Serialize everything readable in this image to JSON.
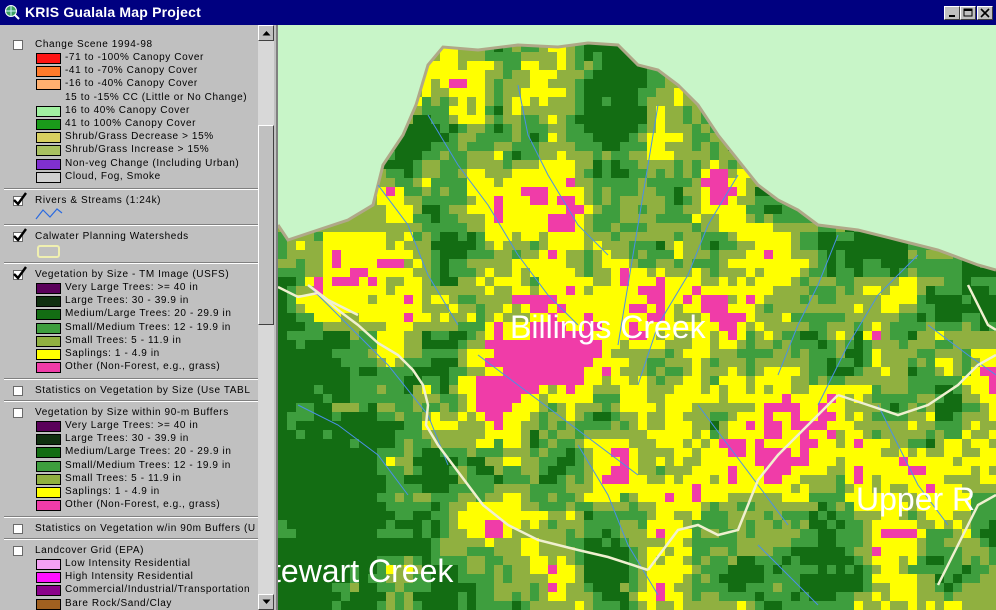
{
  "window": {
    "title": "KRIS Gualala Map Project",
    "minimize": "minimize",
    "maximize": "maximize",
    "close": "close"
  },
  "toc": {
    "groups": [
      {
        "title": "Change Scene 1994-98",
        "checked": false,
        "items": [
          {
            "label": "-71 to -100% Canopy Cover",
            "color": "#ff1414"
          },
          {
            "label": "-41 to -70% Canopy Cover",
            "color": "#ff7a2a"
          },
          {
            "label": "-16 to -40% Canopy Cover",
            "color": "#ffb070"
          },
          {
            "label": "15 to -15% CC (Little or No Change)",
            "color": null
          },
          {
            "label": "16 to 40% Canopy Cover",
            "color": "#a0f0a0"
          },
          {
            "label": "41 to 100% Canopy Cover",
            "color": "#1a9a1a"
          },
          {
            "label": "Shrub/Grass Decrease > 15%",
            "color": "#d8d060"
          },
          {
            "label": "Shrub/Grass Increase > 15%",
            "color": "#a8c060"
          },
          {
            "label": "Non-veg Change (Including Urban)",
            "color": "#8030d0"
          },
          {
            "label": "Cloud, Fog, Smoke",
            "color": "#d0d0d0"
          }
        ]
      },
      {
        "title": "Rivers & Streams (1:24k)",
        "checked": true,
        "items": []
      },
      {
        "title": "Calwater Planning Watersheds",
        "checked": true,
        "items": []
      },
      {
        "title": "Vegetation by Size - TM Image (USFS)",
        "checked": true,
        "items": [
          {
            "label": "Very Large Trees: >= 40  in",
            "color": "#5a005a"
          },
          {
            "label": "Large Trees: 30 - 39.9 in",
            "color": "#103010"
          },
          {
            "label": "Medium/Large Trees: 20 - 29.9 in",
            "color": "#136d13"
          },
          {
            "label": "Small/Medium Trees: 12 - 19.9 in",
            "color": "#3e9e3e"
          },
          {
            "label": "Small Trees: 5 - 11.9 in",
            "color": "#90b040"
          },
          {
            "label": "Saplings: 1 - 4.9 in",
            "color": "#ffff00"
          },
          {
            "label": "Other (Non-Forest, e.g., grass)",
            "color": "#f03ca8"
          }
        ]
      },
      {
        "title": "Statistics on Vegetation by Size (Use TABL",
        "checked": false,
        "items": []
      },
      {
        "title": "Vegetation by Size within 90-m Buffers",
        "checked": false,
        "items": [
          {
            "label": "Very Large Trees: >= 40  in",
            "color": "#5a005a"
          },
          {
            "label": "Large Trees: 30 - 39.9 in",
            "color": "#103010"
          },
          {
            "label": "Medium/Large Trees: 20 - 29.9 in",
            "color": "#136d13"
          },
          {
            "label": "Small/Medium Trees: 12 - 19.9 in",
            "color": "#3e9e3e"
          },
          {
            "label": "Small Trees: 5 - 11.9 in",
            "color": "#90b040"
          },
          {
            "label": "Saplings: 1 - 4.9 in",
            "color": "#ffff00"
          },
          {
            "label": "Other (Non-Forest, e.g., grass)",
            "color": "#f03ca8"
          }
        ]
      },
      {
        "title": "Statistics on Vegetation w/in 90m Buffers (U",
        "checked": false,
        "items": []
      },
      {
        "title": "Landcover Grid (EPA)",
        "checked": false,
        "items": [
          {
            "label": "Low Intensity Residential",
            "color": "#f4a0f4"
          },
          {
            "label": "High Intensity Residential",
            "color": "#ff10ff"
          },
          {
            "label": "Commercial/Industrial/Transportation",
            "color": "#8a008a"
          },
          {
            "label": "Bare Rock/Sand/Clay",
            "color": "#a06020"
          }
        ]
      }
    ]
  },
  "map": {
    "labels": {
      "billings": "Billings Creek",
      "upper": "Upper R",
      "stewart": "tewart Creek"
    },
    "colors": {
      "background": "#c8f5c8",
      "boundary": "#b0a888",
      "pink": "#f03ca8",
      "yellow": "#ffff00",
      "dark_green": "#136d13",
      "mid_green": "#3e9e3e",
      "light_green": "#90b040",
      "stream": "#4a90e8",
      "river": "#f0f0d0"
    }
  },
  "icons": {
    "app": "globe-icon",
    "checkmark": "check-icon",
    "stream_symbol": "stream-line-icon",
    "watershed_symbol": "polygon-outline-icon"
  }
}
